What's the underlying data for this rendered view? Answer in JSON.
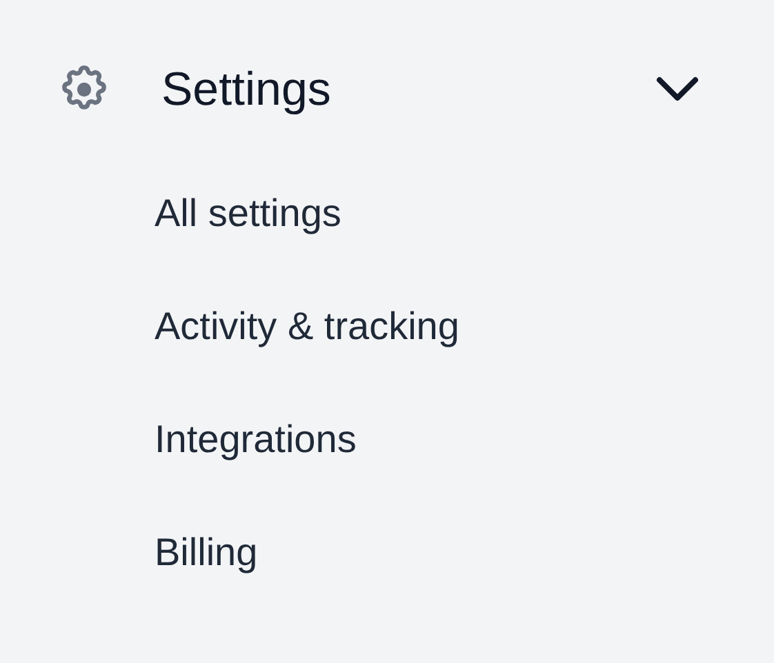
{
  "section": {
    "title": "Settings",
    "expanded": true,
    "items": [
      {
        "label": "All settings"
      },
      {
        "label": "Activity & tracking"
      },
      {
        "label": "Integrations"
      },
      {
        "label": "Billing"
      }
    ]
  }
}
